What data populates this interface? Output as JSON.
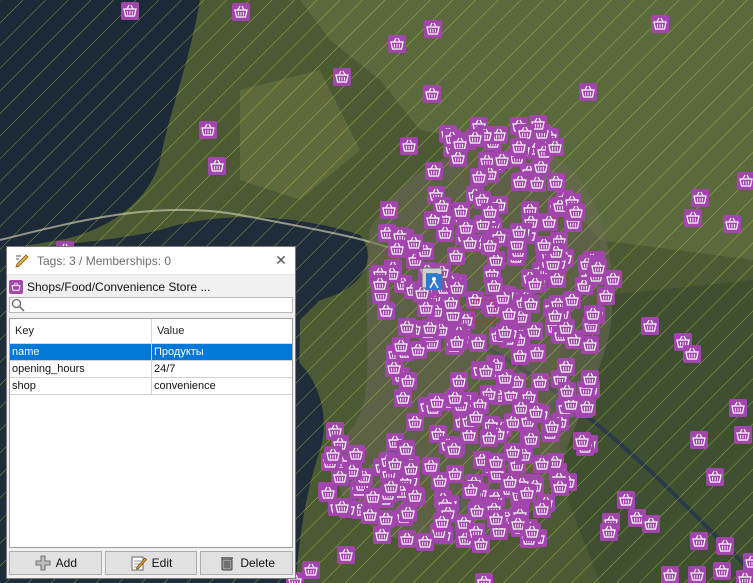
{
  "colors": {
    "shop_marker": "#a245ad",
    "selection": "#0078d7",
    "water": "#1c2a38",
    "land": "#4c5a34"
  },
  "map": {
    "marker_icon": "basket-icon",
    "selected_marker_icon": "basket-icon",
    "other_icons": [
      "building-icon",
      "person-icon"
    ]
  },
  "panel": {
    "title": "Tags: 3 / Memberships: 0",
    "title_icon": "edit-tags-icon",
    "close_icon": "close-icon",
    "preset_label": "Shops/Food/Convenience Store ...",
    "search_placeholder": "",
    "columns": {
      "key": "Key",
      "value": "Value"
    },
    "rows": [
      {
        "key": "name",
        "value": "Продукты"
      },
      {
        "key": "opening_hours",
        "value": "24/7"
      },
      {
        "key": "shop",
        "value": "convenience"
      }
    ],
    "buttons": {
      "add": "Add",
      "edit": "Edit",
      "delete": "Delete"
    }
  }
}
